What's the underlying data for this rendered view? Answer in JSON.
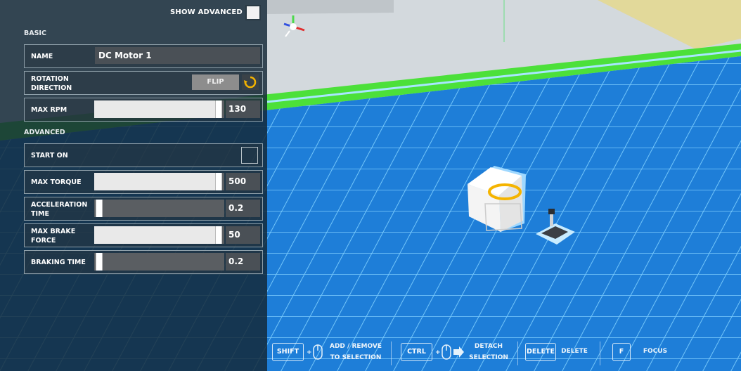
{
  "panel": {
    "show_advanced_label": "SHOW ADVANCED",
    "show_advanced_checked": true,
    "basic_label": "BASIC",
    "advanced_label": "ADVANCED",
    "name_label": "NAME",
    "name_value": "DC Motor 1",
    "rotation_label_line1": "ROTATION",
    "rotation_label_line2": "DIRECTION",
    "flip_label": "FLIP",
    "max_rpm_label": "MAX RPM",
    "max_rpm_value": "130",
    "max_rpm_fraction": 1.0,
    "start_on_label": "START ON",
    "start_on_checked": false,
    "max_torque_label": "MAX TORQUE",
    "max_torque_value": "500",
    "max_torque_fraction": 1.0,
    "accel_label_line1": "ACCELERATION",
    "accel_label_line2": "TIME",
    "accel_value": "0.2",
    "accel_fraction": 0.0,
    "brake_force_label_line1": "MAX BRAKE",
    "brake_force_label_line2": "FORCE",
    "brake_force_value": "50",
    "brake_force_fraction": 1.0,
    "braking_time_label": "BRAKING TIME",
    "braking_time_value": "0.2",
    "braking_time_fraction": 0.0
  },
  "controls": {
    "shift_key": "SHIFT",
    "shift_hint_line1": "ADD / REMOVE",
    "shift_hint_line2": "TO SELECTION",
    "ctrl_key": "CTRL",
    "ctrl_hint_line1": "DETACH",
    "ctrl_hint_line2": "SELECTION",
    "delete_key": "DELETE",
    "delete_hint": "DELETE",
    "focus_key": "F",
    "focus_hint": "FOCUS",
    "plus": "+"
  },
  "icons": {
    "rotation": "rotation-arrow-icon",
    "mouse": "mouse-icon",
    "arrow": "arrow-right-icon",
    "gizmo": "axis-gizmo-icon"
  },
  "colors": {
    "accent_yellow": "#f5b400",
    "floor_blue": "#1e7ed8",
    "green_border": "#4ce03a"
  }
}
